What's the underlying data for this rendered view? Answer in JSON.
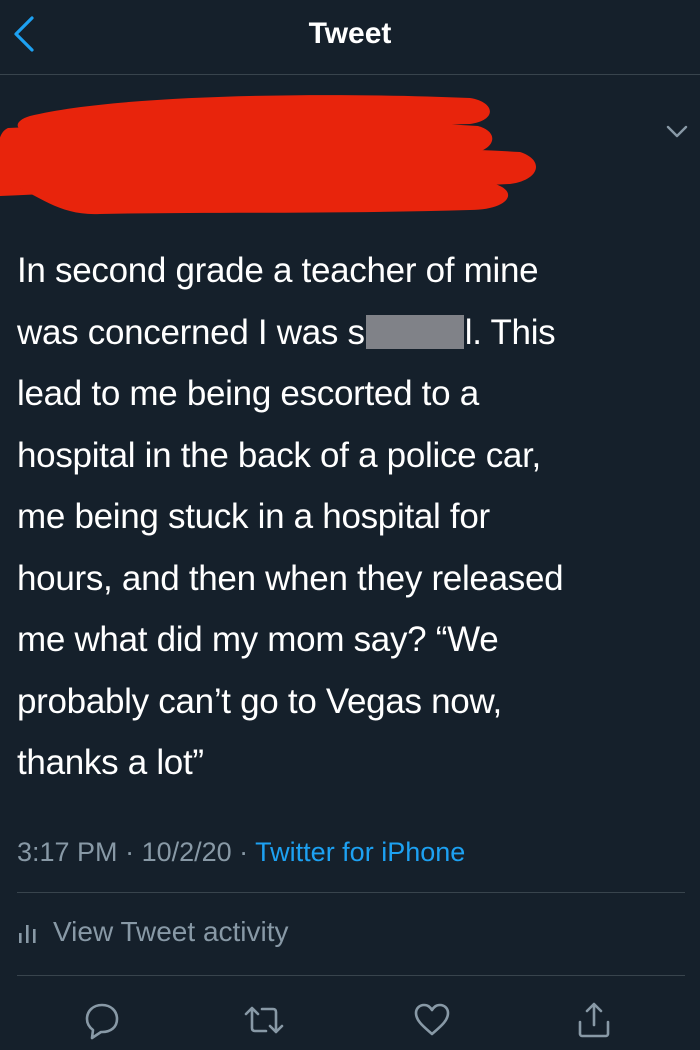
{
  "header": {
    "title": "Tweet"
  },
  "tweet": {
    "lines": {
      "l1": "In second grade a teacher of mine",
      "l2_before": "was concerned I was s",
      "l2_after": "l. This",
      "l3": "lead to me being escorted to a",
      "l4": "hospital in the back of a police car,",
      "l5": "me being stuck in a hospital for",
      "l6": "hours, and then when they released",
      "l7": "me what did my mom say? “We",
      "l8": "probably can’t go to Vegas now,",
      "l9": "thanks a lot”"
    },
    "time": "3:17 PM",
    "separator": " · ",
    "date": "10/2/20",
    "source": "Twitter for iPhone"
  },
  "activity": {
    "label": "View Tweet activity"
  },
  "actions": {
    "icons": [
      "reply-icon",
      "retweet-icon",
      "like-icon",
      "share-icon"
    ]
  },
  "colors": {
    "background": "#15202b",
    "accent": "#1da1f2",
    "secondary_text": "#8899a6",
    "redaction_red": "#e8240c",
    "redaction_gray": "#808288"
  }
}
